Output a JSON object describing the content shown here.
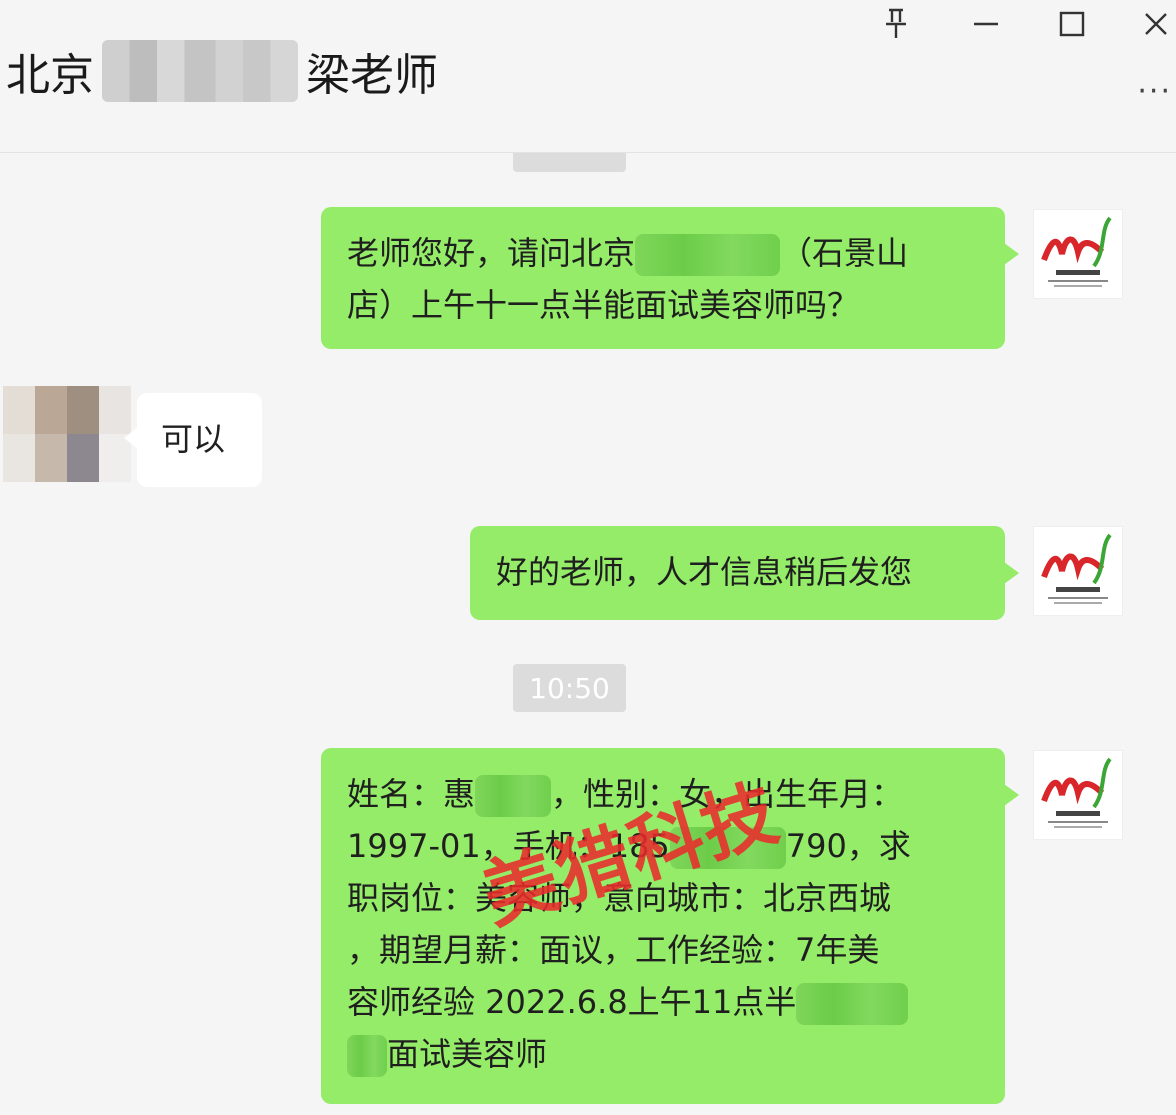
{
  "window": {
    "title_prefix": "北京",
    "title_suffix": "梁老师",
    "controls": {
      "pin": "pin-icon",
      "minimize": "minimize-icon",
      "maximize": "maximize-icon",
      "close": "close-icon",
      "more": "···"
    }
  },
  "colors": {
    "my_bubble": "#95ec69",
    "their_bubble": "#ffffff",
    "timestamp_bg": "#dcdcdc",
    "background": "#f5f5f5",
    "watermark": "#e92b2b",
    "logo_red": "#d9262b",
    "logo_green": "#3aa635"
  },
  "messages": [
    {
      "sender": "me",
      "parts": [
        "老师您好，请问北京",
        "（石景山",
        "店）上午十一点半能面试美容师吗？"
      ]
    },
    {
      "sender": "them",
      "text": "可以"
    },
    {
      "sender": "me",
      "text": "好的老师，人才信息稍后发您"
    },
    {
      "timestamp": "10:50"
    },
    {
      "sender": "me",
      "parts": [
        "姓名：惠",
        "，性别：女，出生年月：",
        "1997-01，手机：185",
        "790，求",
        "职岗位：美容师，意向城市：北京西城",
        "，期望月薪：面议，工作经验：7年美",
        "容师经验 2022.6.8上午11点半",
        "面试美容师"
      ]
    }
  ],
  "watermark": "美猎科技"
}
